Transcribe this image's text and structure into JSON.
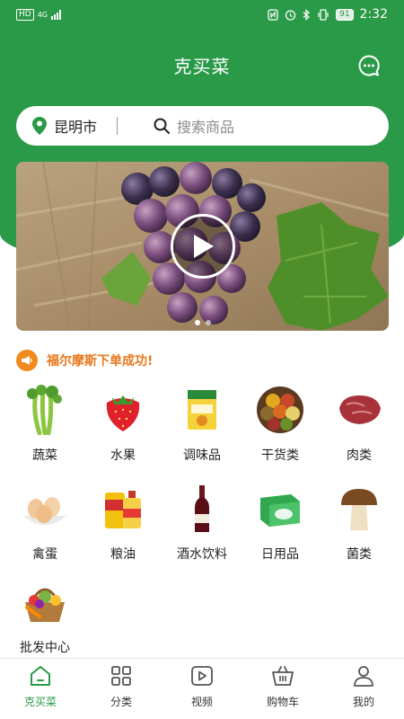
{
  "status_bar": {
    "hd": "HD",
    "network": "4G",
    "battery": "91",
    "time": "2:32"
  },
  "header": {
    "title": "克买菜"
  },
  "search": {
    "city": "昆明市",
    "placeholder": "搜索商品"
  },
  "banner": {
    "slide_count": 2,
    "active_slide": 1
  },
  "notice": {
    "text": "福尔摩斯下单成功!"
  },
  "categories": [
    {
      "label": "蔬菜",
      "icon": "celery-icon"
    },
    {
      "label": "水果",
      "icon": "strawberry-icon"
    },
    {
      "label": "调味品",
      "icon": "seasoning-packet-icon"
    },
    {
      "label": "干货类",
      "icon": "dried-goods-icon"
    },
    {
      "label": "肉类",
      "icon": "meat-icon"
    },
    {
      "label": "禽蛋",
      "icon": "eggs-icon"
    },
    {
      "label": "粮油",
      "icon": "cooking-oil-icon"
    },
    {
      "label": "酒水饮料",
      "icon": "wine-bottle-icon"
    },
    {
      "label": "日用品",
      "icon": "tissue-pack-icon"
    },
    {
      "label": "菌类",
      "icon": "mushroom-icon"
    },
    {
      "label": "批发中心",
      "icon": "veggie-basket-icon"
    }
  ],
  "tabs": [
    {
      "label": "克买菜",
      "icon": "home-icon",
      "active": true
    },
    {
      "label": "分类",
      "icon": "grid-icon",
      "active": false
    },
    {
      "label": "视频",
      "icon": "video-icon",
      "active": false
    },
    {
      "label": "购物车",
      "icon": "cart-icon",
      "active": false
    },
    {
      "label": "我的",
      "icon": "user-icon",
      "active": false
    }
  ],
  "colors": {
    "brand_green": "#2a9a48",
    "notice_orange": "#e8761a"
  }
}
